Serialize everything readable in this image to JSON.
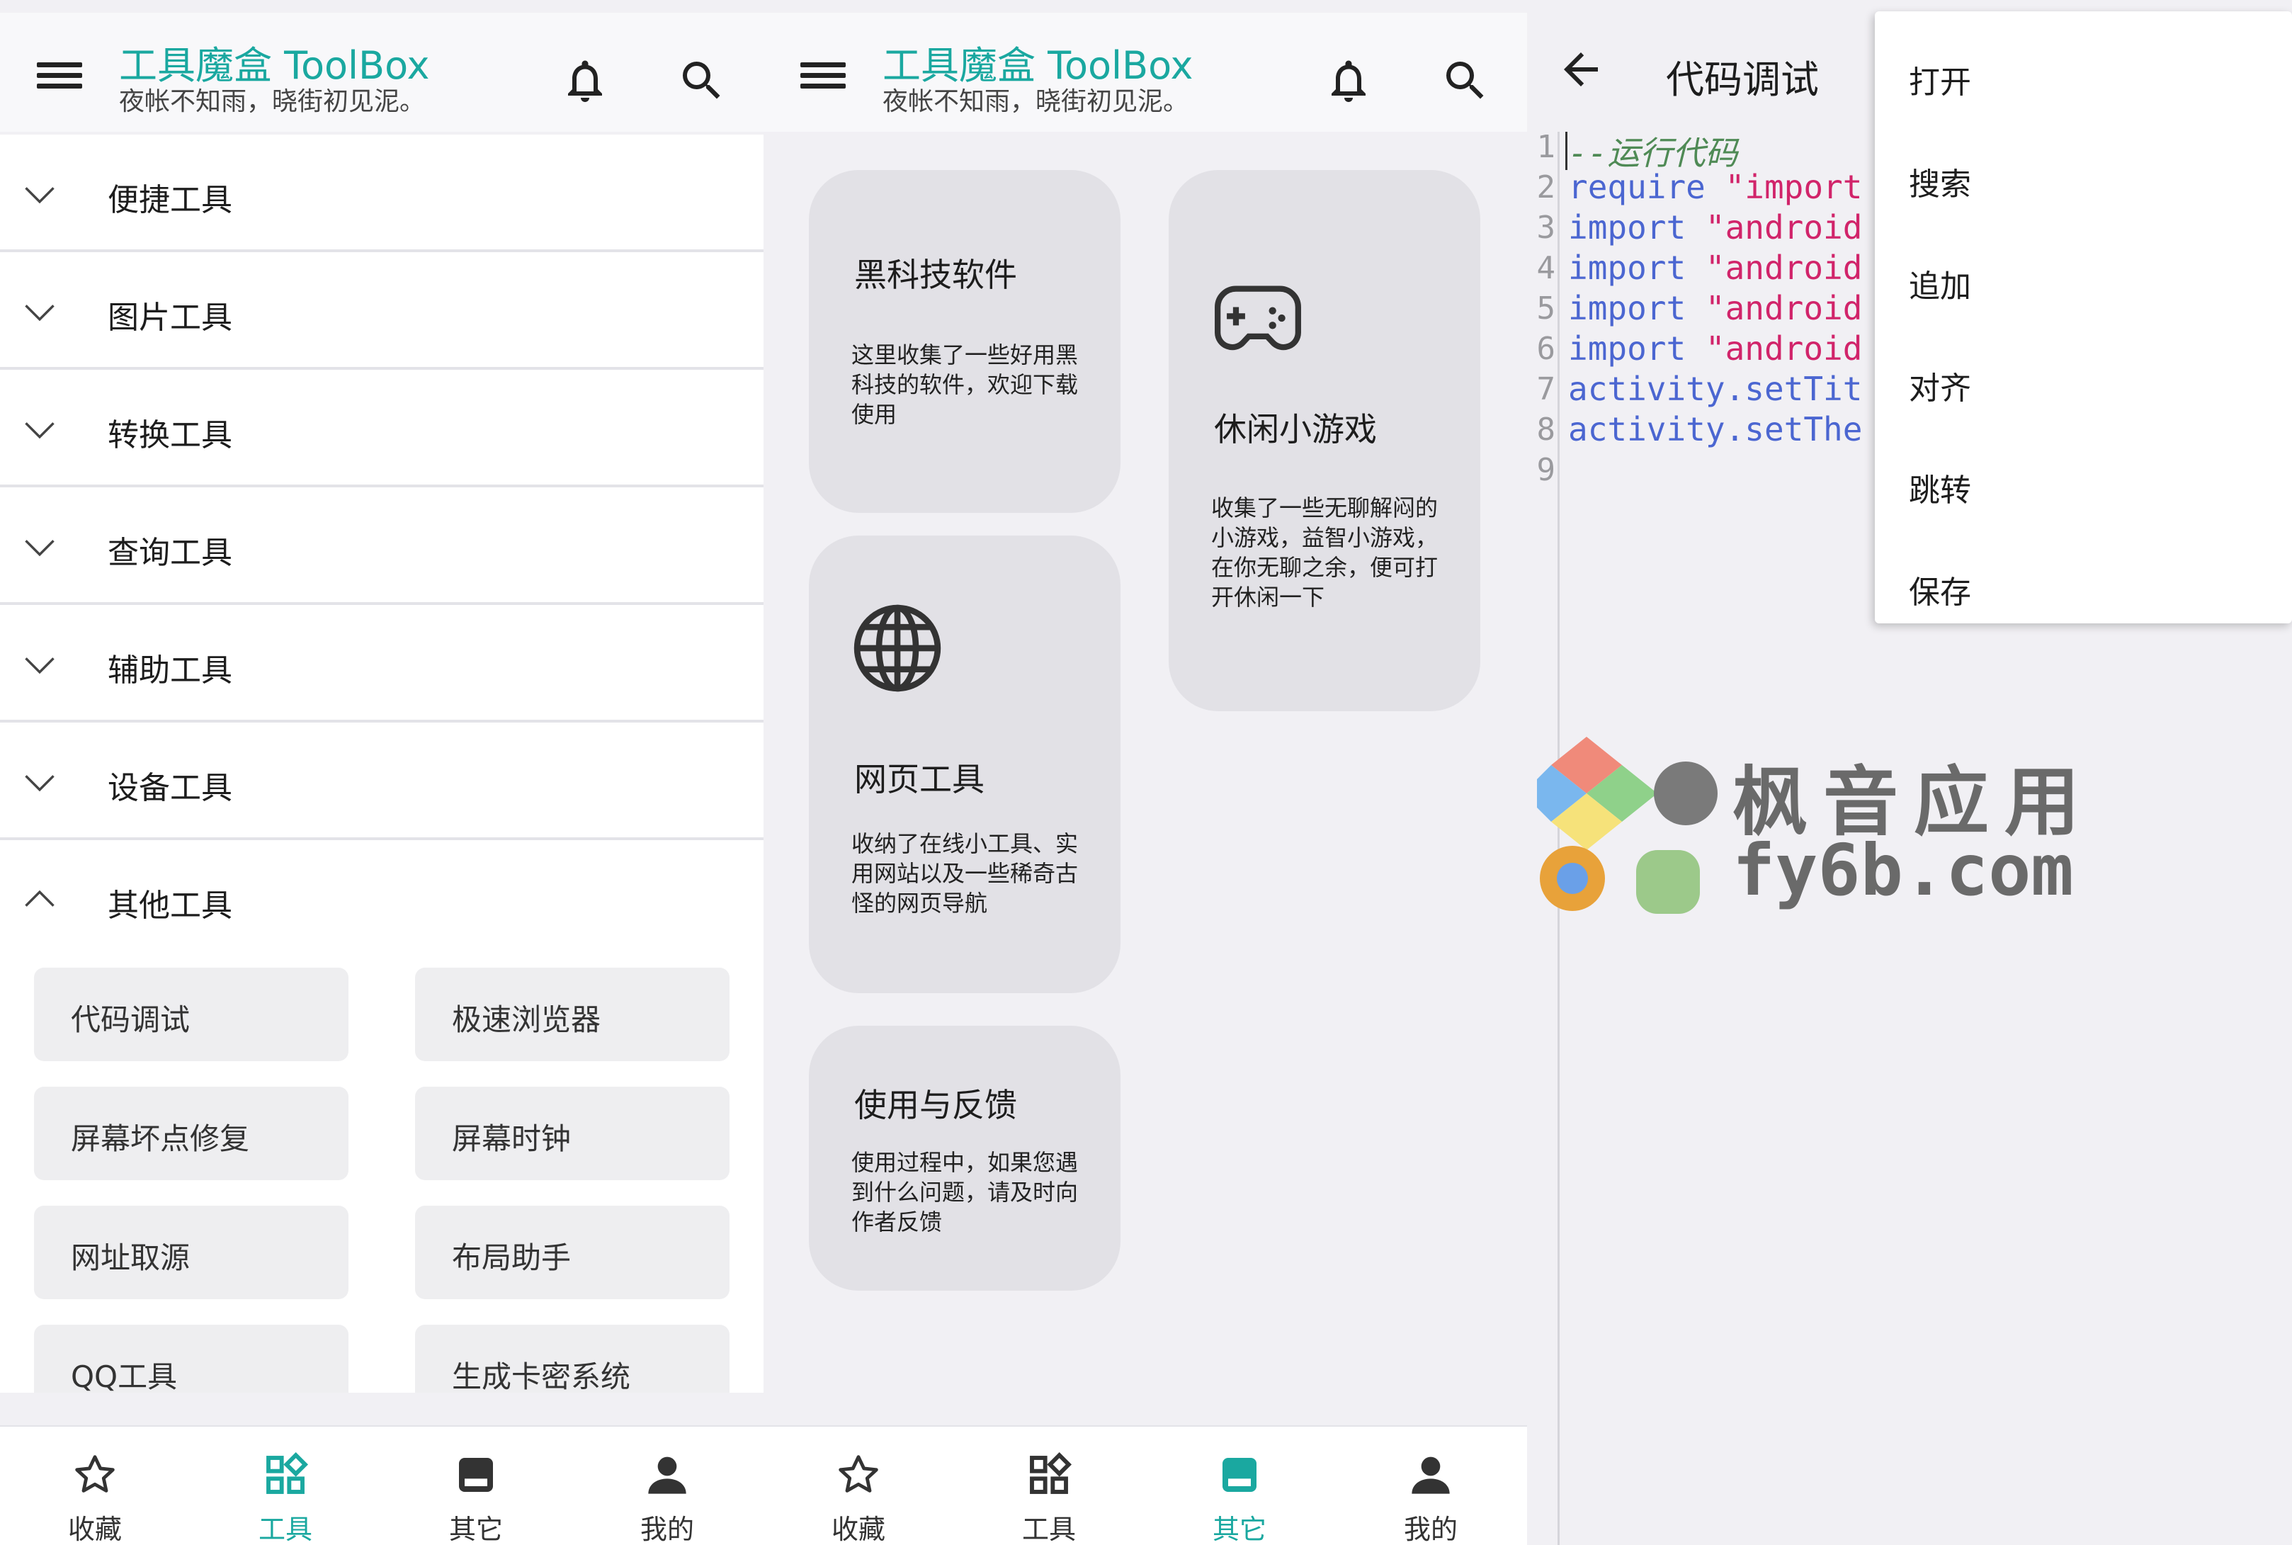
{
  "app": {
    "title": "工具魔盒 ToolBox",
    "subtitle": "夜帐不知雨，晓街初见泥。",
    "accent_color": "#1aa8a0"
  },
  "tools_screen": {
    "categories": [
      {
        "label": "便捷工具",
        "expanded": false
      },
      {
        "label": "图片工具",
        "expanded": false
      },
      {
        "label": "转换工具",
        "expanded": false
      },
      {
        "label": "查询工具",
        "expanded": false
      },
      {
        "label": "辅助工具",
        "expanded": false
      },
      {
        "label": "设备工具",
        "expanded": false
      },
      {
        "label": "其他工具",
        "expanded": true
      }
    ],
    "subitems": [
      "代码调试",
      "极速浏览器",
      "屏幕坏点修复",
      "屏幕时钟",
      "网址取源",
      "布局助手",
      "QQ工具",
      "生成卡密系统"
    ]
  },
  "other_screen": {
    "cards": [
      {
        "title": "黑科技软件",
        "desc": "这里收集了一些好用黑科技的软件，欢迎下载使用",
        "icon": ""
      },
      {
        "title": "休闲小游戏",
        "desc": "收集了一些无聊解闷的小游戏，益智小游戏，在你无聊之余，便可打开休闲一下",
        "icon": "gamepad-icon"
      },
      {
        "title": "网页工具",
        "desc": "收纳了在线小工具、实用网站以及一些稀奇古怪的网页导航",
        "icon": "globe-icon"
      },
      {
        "title": "使用与反馈",
        "desc": "使用过程中，如果您遇到什么问题，请及时向作者反馈",
        "icon": ""
      }
    ]
  },
  "bottom_nav": {
    "items": [
      {
        "label": "收藏",
        "icon": "star-icon"
      },
      {
        "label": "工具",
        "icon": "grid-icon"
      },
      {
        "label": "其它",
        "icon": "box-icon"
      },
      {
        "label": "我的",
        "icon": "person-icon"
      }
    ],
    "active_screen1": "工具",
    "active_screen2": "其它"
  },
  "editor": {
    "title": "代码调试",
    "lines": [
      {
        "num": "1",
        "parts": [
          {
            "t": "--运行代码",
            "c": "cmt"
          }
        ]
      },
      {
        "num": "2",
        "parts": [
          {
            "t": "require",
            "c": "kw"
          },
          {
            "t": " ",
            "c": ""
          },
          {
            "t": "\"import",
            "c": "str"
          }
        ]
      },
      {
        "num": "3",
        "parts": [
          {
            "t": "import",
            "c": "kw"
          },
          {
            "t": " ",
            "c": ""
          },
          {
            "t": "\"android",
            "c": "str"
          }
        ]
      },
      {
        "num": "4",
        "parts": [
          {
            "t": "import",
            "c": "kw"
          },
          {
            "t": " ",
            "c": ""
          },
          {
            "t": "\"android",
            "c": "str"
          }
        ]
      },
      {
        "num": "5",
        "parts": [
          {
            "t": "import",
            "c": "kw"
          },
          {
            "t": " ",
            "c": ""
          },
          {
            "t": "\"android",
            "c": "str"
          }
        ]
      },
      {
        "num": "6",
        "parts": [
          {
            "t": "import",
            "c": "kw"
          },
          {
            "t": " ",
            "c": ""
          },
          {
            "t": "\"android",
            "c": "str"
          }
        ]
      },
      {
        "num": "7",
        "parts": [
          {
            "t": "activity",
            "c": "kw"
          },
          {
            "t": ".setTit",
            "c": "kw2"
          }
        ]
      },
      {
        "num": "8",
        "parts": [
          {
            "t": "activity",
            "c": "kw"
          },
          {
            "t": ".setThe",
            "c": "kw2"
          }
        ]
      },
      {
        "num": "9",
        "parts": []
      }
    ],
    "menu": [
      "打开",
      "搜索",
      "追加",
      "对齐",
      "跳转",
      "保存"
    ]
  },
  "watermark": {
    "line1": "枫音应用",
    "line2": "fy6b.com"
  }
}
